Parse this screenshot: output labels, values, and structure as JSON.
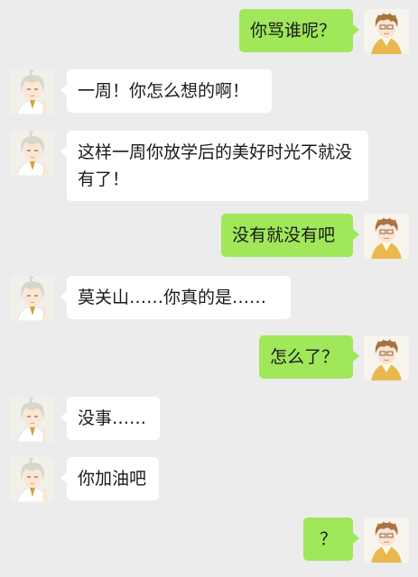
{
  "chat": {
    "messages": [
      {
        "side": "right",
        "text": "你骂谁呢？"
      },
      {
        "side": "left",
        "text": "一周！你怎么想的啊！"
      },
      {
        "side": "left",
        "text": "这样一周你放学后的美好时光不就没有了！"
      },
      {
        "side": "right",
        "text": "没有就没有吧"
      },
      {
        "side": "left",
        "text": "莫关山……你真的是……"
      },
      {
        "side": "right",
        "text": "怎么了？"
      },
      {
        "side": "left",
        "text": "没事……"
      },
      {
        "side": "left",
        "text": "你加油吧"
      },
      {
        "side": "right",
        "text": "？"
      }
    ]
  },
  "colors": {
    "background": "#ececec",
    "bubble_self": "#a0e75a",
    "bubble_other": "#ffffff",
    "text": "#1a1a1a"
  },
  "avatars": {
    "left": "silver-haired-boy-avatar",
    "right": "brown-haired-boy-avatar"
  }
}
